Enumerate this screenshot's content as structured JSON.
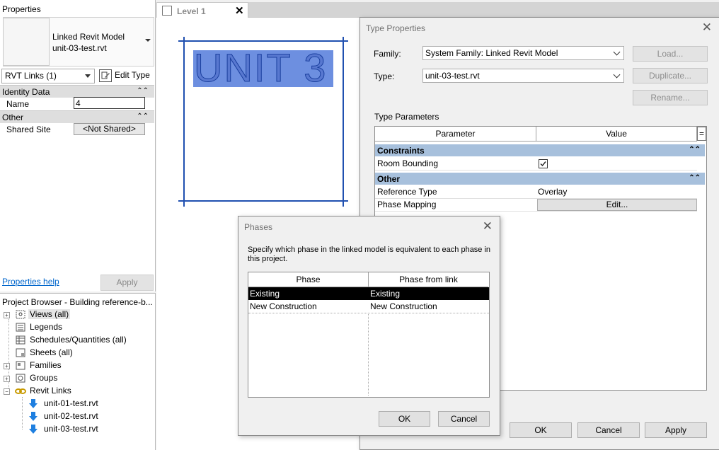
{
  "properties": {
    "title": "Properties",
    "type_name_line1": "Linked Revit Model",
    "type_name_line2": "unit-03-test.rvt",
    "instance_filter": "RVT Links (1)",
    "edit_type_label": "Edit Type",
    "groups": {
      "identity": "Identity Data",
      "other": "Other"
    },
    "rows": {
      "name_label": "Name",
      "name_value": "4",
      "shared_site_label": "Shared Site",
      "shared_site_value": "<Not Shared>"
    },
    "help_link": "Properties help",
    "apply_label": "Apply"
  },
  "browser": {
    "title": "Project Browser - Building reference-b...",
    "items": [
      {
        "label": "Views (all)",
        "icon": "views-icon"
      },
      {
        "label": "Legends",
        "icon": "legend-icon"
      },
      {
        "label": "Schedules/Quantities (all)",
        "icon": "schedule-icon"
      },
      {
        "label": "Sheets (all)",
        "icon": "sheet-icon"
      },
      {
        "label": "Families",
        "icon": "families-icon"
      },
      {
        "label": "Groups",
        "icon": "groups-icon"
      },
      {
        "label": "Revit Links",
        "icon": "revit-links-icon"
      },
      {
        "label": "unit-01-test.rvt",
        "icon": "link-arrow-icon"
      },
      {
        "label": "unit-02-test.rvt",
        "icon": "link-arrow-icon"
      },
      {
        "label": "unit-03-test.rvt",
        "icon": "link-arrow-icon"
      }
    ]
  },
  "view": {
    "tab_label": "Level 1",
    "unit_text": "UNIT 3"
  },
  "type_properties": {
    "title": "Type Properties",
    "family_label": "Family:",
    "family_value": "System Family: Linked Revit Model",
    "type_label": "Type:",
    "type_value": "unit-03-test.rvt",
    "load_button": "Load...",
    "duplicate_button": "Duplicate...",
    "rename_button": "Rename...",
    "section_label": "Type Parameters",
    "col_parameter": "Parameter",
    "col_value": "Value",
    "col_eq": "=",
    "constraints_group": "Constraints",
    "room_bounding_label": "Room Bounding",
    "room_bounding_checked": true,
    "other_group": "Other",
    "reference_type_label": "Reference Type",
    "reference_type_value": "Overlay",
    "phase_mapping_label": "Phase Mapping",
    "phase_mapping_button": "Edit...",
    "ok": "OK",
    "cancel": "Cancel",
    "apply": "Apply"
  },
  "phases": {
    "title": "Phases",
    "instruction": "Specify which phase in the linked model is equivalent to each phase in this project.",
    "col_phase": "Phase",
    "col_phase_from_link": "Phase from link",
    "rows": [
      {
        "phase": "Existing",
        "from_link": "Existing"
      },
      {
        "phase": "New Construction",
        "from_link": "New Construction"
      }
    ],
    "ok": "OK",
    "cancel": "Cancel"
  }
}
